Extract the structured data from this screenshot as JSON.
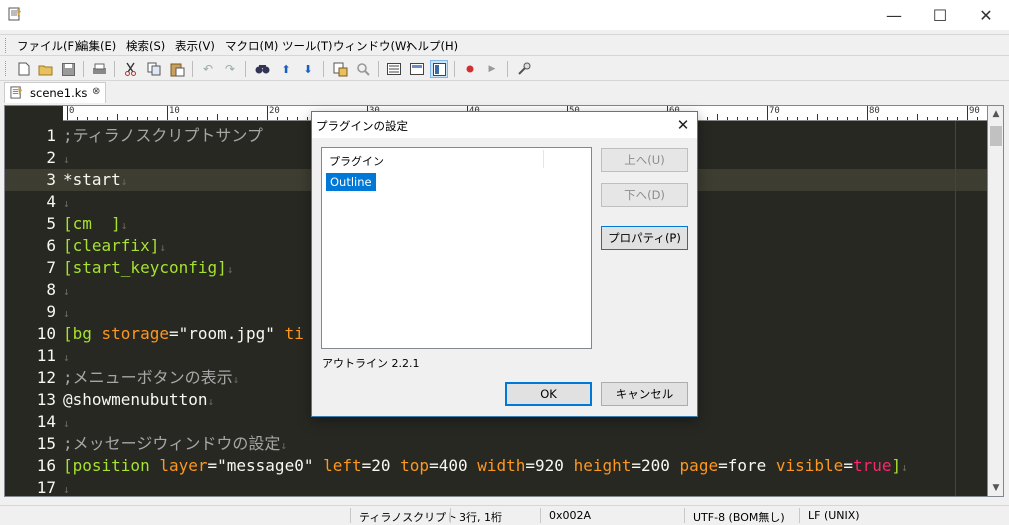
{
  "window": {
    "app_icon": "notepad-icon",
    "minimize": "—",
    "maximize": "☐",
    "close": "✕"
  },
  "menu": [
    "ファイル(F)",
    "編集(E)",
    "検索(S)",
    "表示(V)",
    "マクロ(M)",
    "ツール(T)",
    "ウィンドウ(W)",
    "ヘルプ(H)"
  ],
  "toolbar_icons": [
    "new-file-icon",
    "open-folder-icon",
    "save-icon",
    "print-icon",
    "cut-icon",
    "copy-icon",
    "paste-icon",
    "undo-icon",
    "redo-icon",
    "find-icon",
    "find-up-icon",
    "find-down-icon",
    "replace-icon",
    "grep-icon",
    "outline-icon",
    "view-icon",
    "layout-icon",
    "record-macro-icon",
    "play-macro-icon",
    "settings-icon"
  ],
  "tab": {
    "label": "scene1.ks",
    "close": "⊗"
  },
  "ruler": [
    "0",
    "10",
    "20",
    "30",
    "40",
    "50",
    "60",
    "70",
    "80",
    "90"
  ],
  "lines": [
    {
      "n": "1",
      "parts": [
        {
          "t": ";ティラノスクリプトサンプ",
          "c": "c-com"
        }
      ]
    },
    {
      "n": "2",
      "parts": [
        {
          "t": "↓",
          "c": "c-eol"
        }
      ]
    },
    {
      "n": "3",
      "parts": [
        {
          "t": "*start",
          "c": "c-str"
        },
        {
          "t": "↓",
          "c": "c-eol"
        }
      ]
    },
    {
      "n": "4",
      "parts": [
        {
          "t": "↓",
          "c": "c-eol"
        }
      ]
    },
    {
      "n": "5",
      "parts": [
        {
          "t": "[cm  ]",
          "c": "c-tag"
        },
        {
          "t": "↓",
          "c": "c-eol"
        }
      ]
    },
    {
      "n": "6",
      "parts": [
        {
          "t": "[clearfix]",
          "c": "c-tag"
        },
        {
          "t": "↓",
          "c": "c-eol"
        }
      ]
    },
    {
      "n": "7",
      "parts": [
        {
          "t": "[start_keyconfig]",
          "c": "c-tag"
        },
        {
          "t": "↓",
          "c": "c-eol"
        }
      ]
    },
    {
      "n": "8",
      "parts": [
        {
          "t": "↓",
          "c": "c-eol"
        }
      ]
    },
    {
      "n": "9",
      "parts": [
        {
          "t": "↓",
          "c": "c-eol"
        }
      ]
    },
    {
      "n": "10",
      "parts": [
        {
          "t": "[bg ",
          "c": "c-tag"
        },
        {
          "t": "storage",
          "c": "c-attr"
        },
        {
          "t": "=\"room.jpg\" ",
          "c": "c-str"
        },
        {
          "t": "ti",
          "c": "c-attr"
        }
      ]
    },
    {
      "n": "11",
      "parts": [
        {
          "t": "↓",
          "c": "c-eol"
        }
      ]
    },
    {
      "n": "12",
      "parts": [
        {
          "t": ";メニューボタンの表示",
          "c": "c-com"
        },
        {
          "t": "↓",
          "c": "c-eol"
        }
      ]
    },
    {
      "n": "13",
      "parts": [
        {
          "t": "@showmenubutton",
          "c": "c-str"
        },
        {
          "t": "↓",
          "c": "c-eol"
        }
      ]
    },
    {
      "n": "14",
      "parts": [
        {
          "t": "↓",
          "c": "c-eol"
        }
      ]
    },
    {
      "n": "15",
      "parts": [
        {
          "t": ";メッセージウィンドウの設定",
          "c": "c-com"
        },
        {
          "t": "↓",
          "c": "c-eol"
        }
      ]
    },
    {
      "n": "16",
      "parts": [
        {
          "t": "[position ",
          "c": "c-tag"
        },
        {
          "t": "layer",
          "c": "c-attr"
        },
        {
          "t": "=\"message0\" ",
          "c": "c-str"
        },
        {
          "t": "left",
          "c": "c-attr"
        },
        {
          "t": "=20 ",
          "c": "c-str"
        },
        {
          "t": "top",
          "c": "c-attr"
        },
        {
          "t": "=400 ",
          "c": "c-str"
        },
        {
          "t": "width",
          "c": "c-attr"
        },
        {
          "t": "=920 ",
          "c": "c-str"
        },
        {
          "t": "height",
          "c": "c-attr"
        },
        {
          "t": "=200 ",
          "c": "c-str"
        },
        {
          "t": "page",
          "c": "c-attr"
        },
        {
          "t": "=fore ",
          "c": "c-str"
        },
        {
          "t": "visible",
          "c": "c-attr"
        },
        {
          "t": "=",
          "c": "c-str"
        },
        {
          "t": "true",
          "c": "c-red"
        },
        {
          "t": "]",
          "c": "c-tag"
        },
        {
          "t": "↓",
          "c": "c-eol"
        }
      ]
    },
    {
      "n": "17",
      "parts": [
        {
          "t": "↓",
          "c": "c-eol"
        }
      ]
    }
  ],
  "status": {
    "mode": "ティラノスクリプト",
    "position": "3行, 1桁",
    "code": "0x002A",
    "encoding": "UTF-8 (BOM無し)",
    "newline": "LF (UNIX)"
  },
  "dialog": {
    "title": "プラグインの設定",
    "close": "✕",
    "list_header": "プラグイン",
    "items": [
      "Outline"
    ],
    "btn_up": "上へ(U)",
    "btn_down": "下へ(D)",
    "btn_props": "プロパティ(P)",
    "info": "アウトライン 2.2.1",
    "ok": "OK",
    "cancel": "キャンセル"
  }
}
